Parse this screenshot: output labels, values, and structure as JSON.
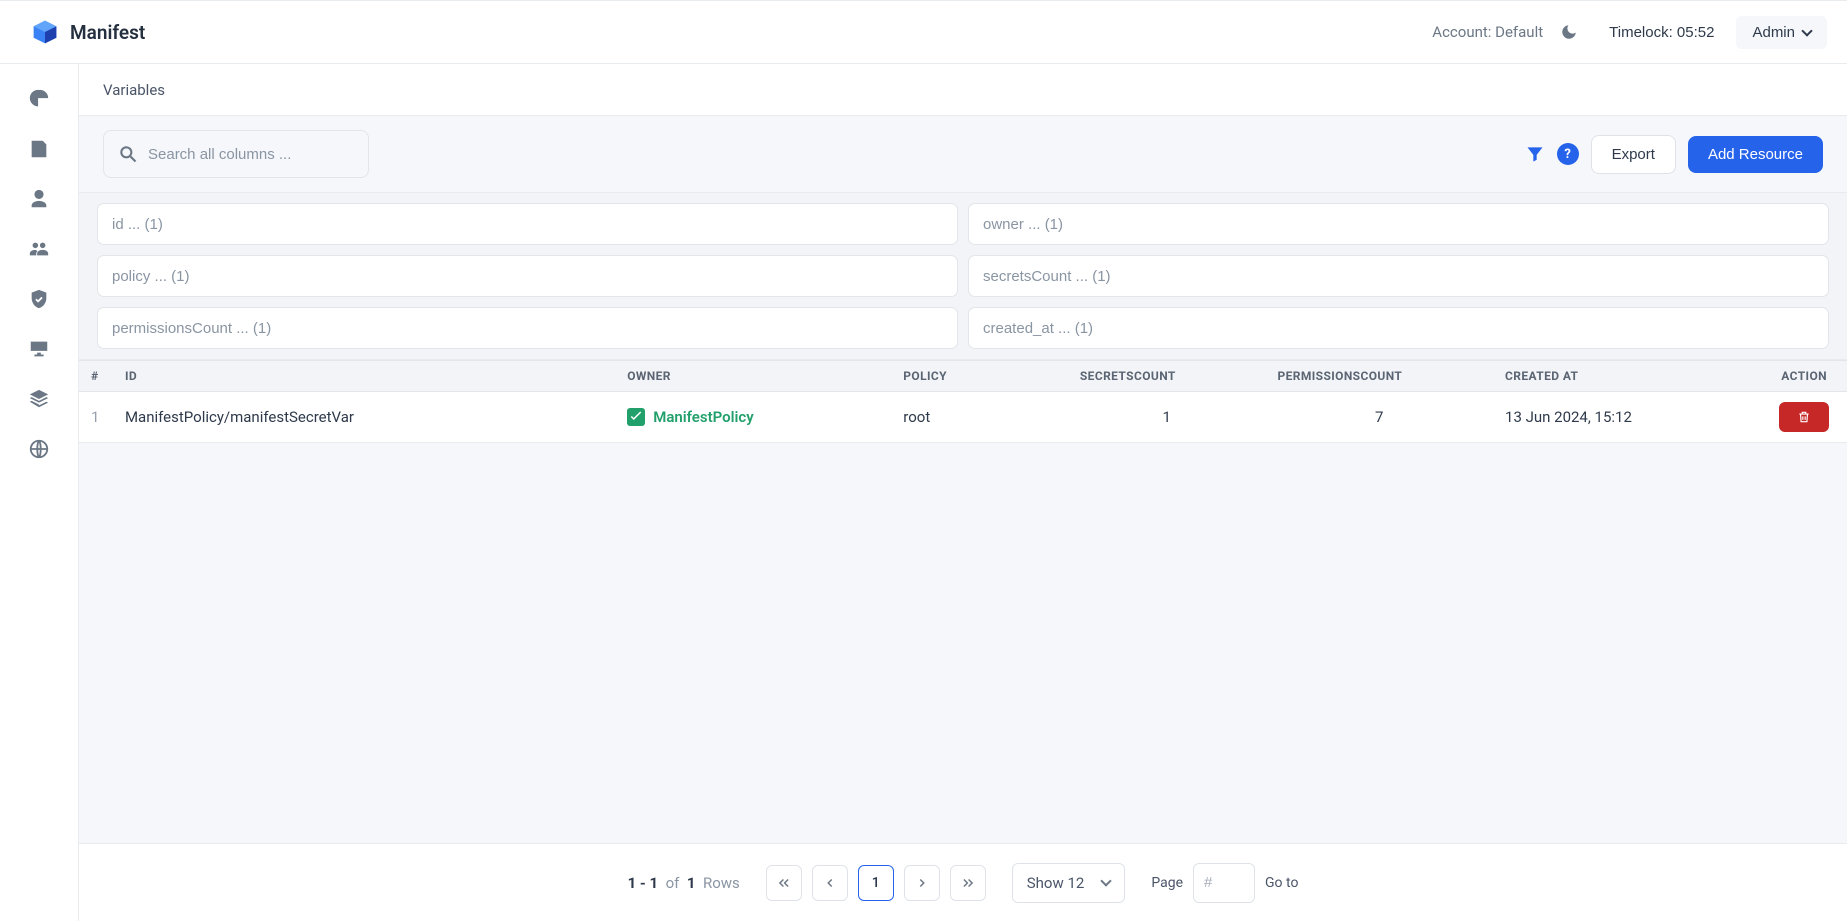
{
  "brand": {
    "name": "Manifest"
  },
  "topbar": {
    "account_label": "Account: Default",
    "timelock_label": "Timelock: 05:52",
    "user_label": "Admin"
  },
  "breadcrumb": {
    "title": "Variables"
  },
  "toolbar": {
    "search_placeholder": "Search all columns ...",
    "export_label": "Export",
    "add_label": "Add Resource"
  },
  "filters": {
    "id_placeholder": "id ... (1)",
    "owner_placeholder": "owner ... (1)",
    "policy_placeholder": "policy ... (1)",
    "secrets_placeholder": "secretsCount ... (1)",
    "permissions_placeholder": "permissionsCount ... (1)",
    "created_placeholder": "created_at ... (1)"
  },
  "columns": {
    "num": "#",
    "id": "ID",
    "owner": "OWNER",
    "policy": "POLICY",
    "secrets": "SECRETSCOUNT",
    "permissions": "PERMISSIONSCOUNT",
    "created": "CREATED AT",
    "action": "ACTION"
  },
  "rows": [
    {
      "num": "1",
      "id": "ManifestPolicy/manifestSecretVar",
      "owner": "ManifestPolicy",
      "policy": "root",
      "secrets": "1",
      "permissions": "7",
      "created": "13 Jun 2024, 15:12"
    }
  ],
  "pager": {
    "range": "1 - 1",
    "of_label": "of",
    "total": "1",
    "rows_label": "Rows",
    "current": "1",
    "show_label": "Show 12",
    "page_label": "Page",
    "goto_placeholder": "#",
    "goto_label": "Go to"
  }
}
